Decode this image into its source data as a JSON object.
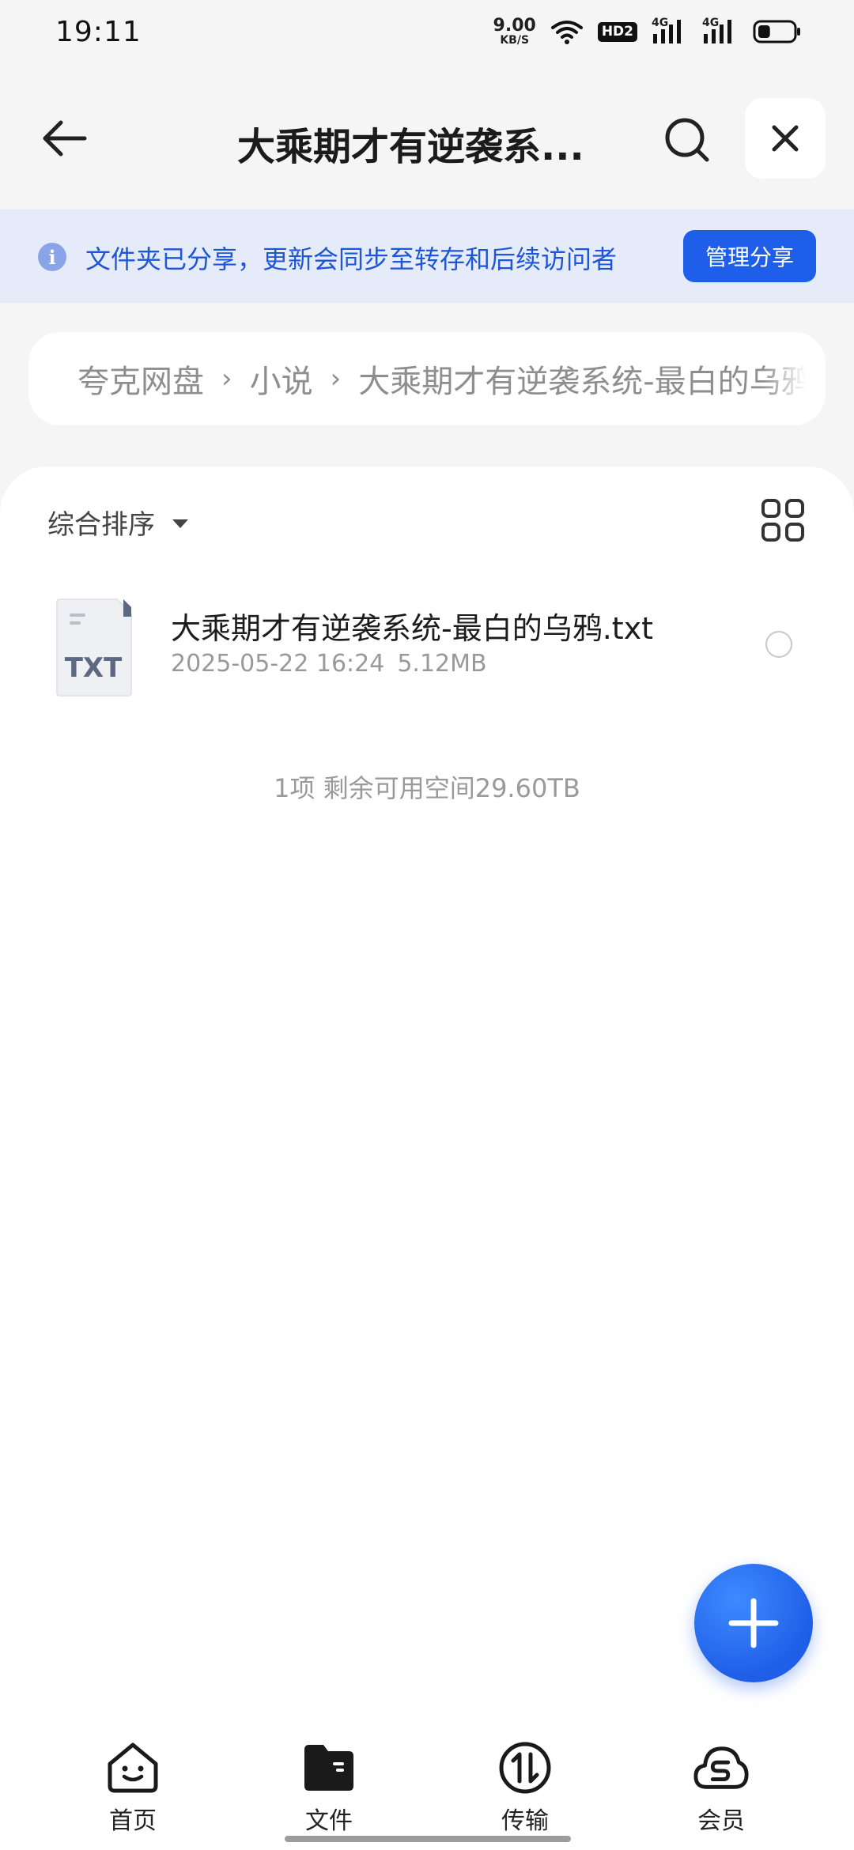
{
  "status_bar": {
    "time": "19:11",
    "net_speed_value": "9.00",
    "net_speed_unit": "KB/S",
    "hd_badge": "HD2",
    "signal_1": "4G",
    "signal_2": "4G",
    "battery_level": 0.35
  },
  "header": {
    "title": "大乘期才有逆袭系...",
    "back_icon": "arrow-left-icon",
    "search_icon": "search-icon",
    "close_icon": "close-icon"
  },
  "notice": {
    "text": "文件夹已分享，更新会同步至转存和后续访问者",
    "manage_label": "管理分享"
  },
  "breadcrumb": {
    "items": [
      "夸克网盘",
      "小说",
      "大乘期才有逆袭系统-最白的乌鸦"
    ]
  },
  "toolbar": {
    "sort_label": "综合排序"
  },
  "files": [
    {
      "type_label": "TXT",
      "name": "大乘期才有逆袭系统-最白的乌鸦.txt",
      "date": "2025-05-22 16:24",
      "size": "5.12MB"
    }
  ],
  "summary": "1项 剩余可用空间29.60TB",
  "bottom_nav": {
    "items": [
      {
        "label": "首页",
        "icon": "home-face-icon"
      },
      {
        "label": "文件",
        "icon": "folder-icon"
      },
      {
        "label": "传输",
        "icon": "transfer-icon"
      },
      {
        "label": "会员",
        "icon": "cloud-s-icon"
      }
    ]
  },
  "colors": {
    "accent": "#1f5ee8",
    "notice_bg": "#e6ebf9",
    "notice_text": "#1e56d6"
  }
}
